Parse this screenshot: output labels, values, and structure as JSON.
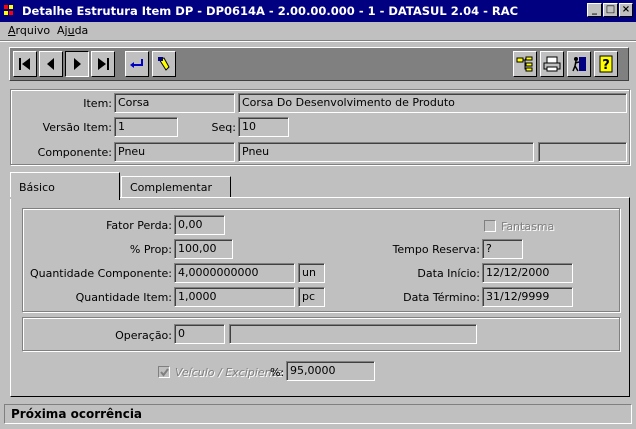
{
  "window": {
    "title": "Detalhe Estrutura Item DP - DP0614A - 2.00.00.000 - 1 - DATASUL 2.04 - RAC"
  },
  "menu": {
    "items": [
      "Arquivo",
      "Ajuda"
    ]
  },
  "header": {
    "item_label": "Item:",
    "item_code": "Corsa",
    "item_desc": "Corsa Do Desenvolvimento de Produto",
    "versao_label": "Versão Item:",
    "versao_value": "1",
    "seq_label": "Seq:",
    "seq_value": "10",
    "componente_label": "Componente:",
    "componente_code": "Pneu",
    "componente_desc": "Pneu",
    "componente_extra": ""
  },
  "tabs": [
    {
      "label": "Básico",
      "active": true
    },
    {
      "label": "Complementar",
      "active": false
    }
  ],
  "basico": {
    "fator_perda_label": "Fator Perda:",
    "fator_perda": "0,00",
    "prop_label": "% Prop:",
    "prop": "100,00",
    "qtd_comp_label": "Quantidade Componente:",
    "qtd_comp": "4,0000000000",
    "qtd_comp_un": "un",
    "qtd_item_label": "Quantidade Item:",
    "qtd_item": "1,0000",
    "qtd_item_un": "pc",
    "fantasma_label": "Fantasma",
    "fantasma_checked": false,
    "tempo_reserva_label": "Tempo Reserva:",
    "tempo_reserva": "?",
    "data_inicio_label": "Data Início:",
    "data_inicio": "12/12/2000",
    "data_termino_label": "Data Término:",
    "data_termino": "31/12/9999",
    "operacao_label": "Operação:",
    "operacao_code": "0",
    "operacao_desc": "",
    "veiculo_label": "Veículo / Excipiente",
    "veiculo_checked": true,
    "pct_label": "%:",
    "pct_value": "95,0000"
  },
  "status": {
    "text": "Próxima ocorrência"
  },
  "colors": {
    "titlebar": "#000080",
    "face": "#c0c0c0",
    "toolbar": "#808080"
  }
}
